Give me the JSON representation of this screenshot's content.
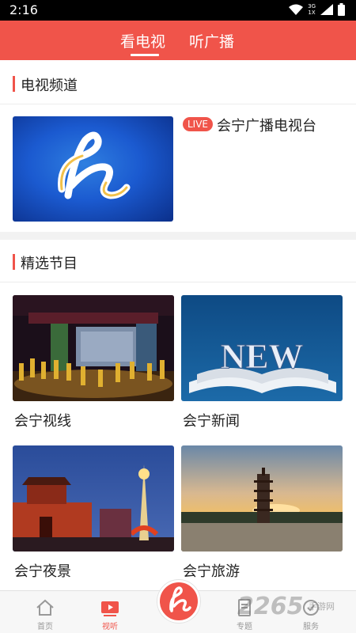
{
  "status_bar": {
    "time": "2:16",
    "network_top": "3G",
    "network_bottom": "1X"
  },
  "header": {
    "tabs": [
      {
        "label": "看电视",
        "active": true
      },
      {
        "label": "听广播",
        "active": false
      }
    ]
  },
  "sections": {
    "channels_title": "电视频道",
    "featured_title": "精选节目"
  },
  "channel": {
    "badge": "LIVE",
    "name": "会宁广播电视台"
  },
  "programs": [
    {
      "label": "会宁视线"
    },
    {
      "label": "会宁新闻",
      "thumb_text": "NEW"
    },
    {
      "label": "会宁夜景"
    },
    {
      "label": "会宁旅游"
    }
  ],
  "bottom_nav": {
    "items": [
      {
        "label": "首页"
      },
      {
        "label": "视听",
        "active": true
      },
      {
        "label": "专题"
      },
      {
        "label": "服务"
      }
    ]
  },
  "watermark": {
    "main": "2265",
    "sub": "手游网"
  },
  "colors": {
    "accent": "#f0544a",
    "inactive": "#999999"
  }
}
